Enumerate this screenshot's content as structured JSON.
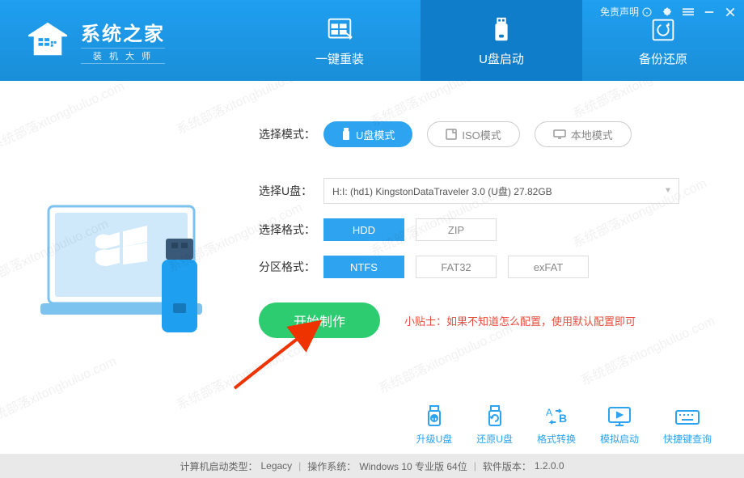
{
  "titlebar": {
    "disclaimer": "免责声明"
  },
  "logo": {
    "title": "系统之家",
    "subtitle": "装 机 大 师"
  },
  "tabs": [
    {
      "id": "reinstall",
      "label": "一键重装"
    },
    {
      "id": "usb-boot",
      "label": "U盘启动",
      "active": true
    },
    {
      "id": "backup",
      "label": "备份还原"
    }
  ],
  "form": {
    "mode_label": "选择模式：",
    "modes": [
      {
        "id": "usb",
        "label": "U盘模式",
        "selected": true
      },
      {
        "id": "iso",
        "label": "ISO模式"
      },
      {
        "id": "local",
        "label": "本地模式"
      }
    ],
    "disk_label": "选择U盘：",
    "disk_value": "H:I: (hd1) KingstonDataTraveler 3.0 (U盘) 27.82GB",
    "format_label": "选择格式：",
    "formats": [
      {
        "id": "hdd",
        "label": "HDD",
        "selected": true
      },
      {
        "id": "zip",
        "label": "ZIP"
      }
    ],
    "partition_label": "分区格式：",
    "partitions": [
      {
        "id": "ntfs",
        "label": "NTFS",
        "selected": true
      },
      {
        "id": "fat32",
        "label": "FAT32"
      },
      {
        "id": "exfat",
        "label": "exFAT"
      }
    ],
    "start_button": "开始制作",
    "tip": "小贴士：如果不知道怎么配置，使用默认配置即可"
  },
  "tools": [
    {
      "id": "upgrade",
      "label": "升级U盘"
    },
    {
      "id": "restore",
      "label": "还原U盘"
    },
    {
      "id": "convert",
      "label": "格式转换"
    },
    {
      "id": "simulate",
      "label": "模拟启动"
    },
    {
      "id": "hotkey",
      "label": "快捷键查询"
    }
  ],
  "statusbar": {
    "boot_type_label": "计算机启动类型：",
    "boot_type": "Legacy",
    "os_label": "操作系统：",
    "os": "Windows 10 专业版 64位",
    "version_label": "软件版本：",
    "version": "1.2.0.0"
  },
  "watermark": "系统部落xitongbuluo.com"
}
